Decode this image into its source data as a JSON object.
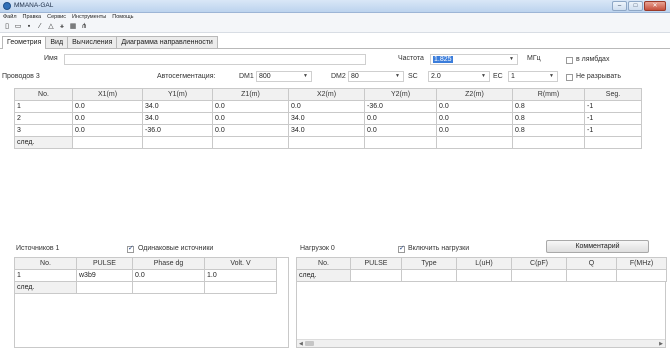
{
  "window": {
    "title": "MMANA-GAL",
    "min_label": "‒",
    "max_label": "□",
    "close_label": "✕"
  },
  "menu": [
    "Файл",
    "Правка",
    "Сервис",
    "Инструменты",
    "Помощь"
  ],
  "toolbar": {
    "icons": [
      "new-file-icon",
      "open-folder-icon",
      "save-icon",
      "pencil-icon",
      "triangle-icon",
      "antenna-icon",
      "table-icon",
      "chart-icon"
    ],
    "glyphs": [
      "▯",
      "▭",
      "▪",
      "⁄",
      "△",
      "⚹",
      "▦",
      "⋔"
    ]
  },
  "tabs": [
    "Геометрия",
    "Вид",
    "Вычисления",
    "Диаграмма направленности"
  ],
  "form": {
    "name_label": "Имя",
    "name_value": "",
    "freq_label": "Частота",
    "freq_value": "1.825",
    "freq_unit": "МГц",
    "lambda_label": "в лямбдах",
    "wires_label": "Проводов 3",
    "autoseg_label": "Автосегментация:",
    "dm1_label": "DM1",
    "dm1_value": "800",
    "dm2_label": "DM2",
    "dm2_value": "80",
    "sc_label": "SC",
    "sc_value": "2.0",
    "ec_label": "EC",
    "ec_value": "1",
    "nobreak_label": "Не разрывать"
  },
  "wires_table": {
    "columns": [
      "No.",
      "X1(m)",
      "Y1(m)",
      "Z1(m)",
      "X2(m)",
      "Y2(m)",
      "Z2(m)",
      "R(mm)",
      "Seg."
    ],
    "rows": [
      [
        "1",
        "0.0",
        "34.0",
        "0.0",
        "0.0",
        "-36.0",
        "0.0",
        "0.8",
        "-1"
      ],
      [
        "2",
        "0.0",
        "34.0",
        "0.0",
        "34.0",
        "0.0",
        "0.0",
        "0.8",
        "-1"
      ],
      [
        "3",
        "0.0",
        "-36.0",
        "0.0",
        "34.0",
        "0.0",
        "0.0",
        "0.8",
        "-1"
      ],
      [
        "след.",
        "",
        "",
        "",
        "",
        "",
        "",
        "",
        ""
      ]
    ]
  },
  "sources": {
    "label": "Источников 1",
    "same_label": "Одинаковые источники",
    "columns": [
      "No.",
      "PULSE",
      "Phase dg",
      "Volt. V"
    ],
    "rows": [
      [
        "1",
        "w3b9",
        "0.0",
        "1.0"
      ],
      [
        "след.",
        "",
        "",
        ""
      ]
    ]
  },
  "loads": {
    "label": "Нагрузок 0",
    "enable_label": "Включить нагрузки",
    "comment_button": "Комментарий",
    "columns": [
      "No.",
      "PULSE",
      "Type",
      "L(uH)",
      "C(pF)",
      "Q",
      "F(MHz)"
    ],
    "rows": [
      [
        "след.",
        "",
        "",
        "",
        "",
        "",
        ""
      ]
    ]
  }
}
